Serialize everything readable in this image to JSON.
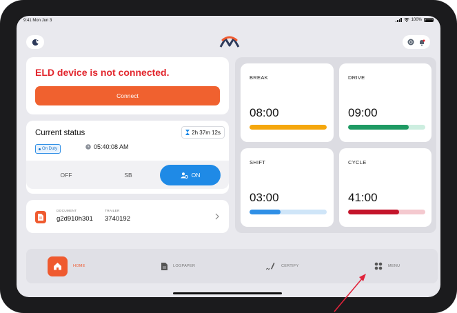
{
  "status_bar": {
    "time": "9:41 Mon Jun 3",
    "battery": "100%"
  },
  "eld": {
    "message": "ELD device is not connected.",
    "connect_label": "Connect"
  },
  "current_status": {
    "title": "Current status",
    "timer": "2h 37m 12s",
    "duty_badge": "On Duty",
    "clock_time": "05:40:08 AM",
    "options": [
      "OFF",
      "SB",
      "ON"
    ],
    "selected": "ON"
  },
  "document": {
    "document_label": "DOCUMENT",
    "document_value": "g2d910h301",
    "trailer_label": "TRAILER",
    "trailer_value": "3740192"
  },
  "timers": [
    {
      "label": "BREAK",
      "time": "08:00",
      "progress": 1.0,
      "color": "#f5a70d",
      "track": "#fde7b3"
    },
    {
      "label": "DRIVE",
      "time": "09:00",
      "progress": 0.79,
      "color": "#1e9a63",
      "track": "#cdeee0"
    },
    {
      "label": "SHIFT",
      "time": "03:00",
      "progress": 0.4,
      "color": "#2f8fe6",
      "track": "#cfe5f8"
    },
    {
      "label": "CYCLE",
      "time": "41:00",
      "progress": 0.66,
      "color": "#c4152b",
      "track": "#f4c9cf"
    }
  ],
  "nav": {
    "home": "HOME",
    "logpaper": "LOGPAPER",
    "certify": "CERTIFY",
    "menu": "MENU"
  },
  "colors": {
    "accent": "#f0612f",
    "on_blue": "#1f8ae6",
    "error": "#e2252c"
  }
}
